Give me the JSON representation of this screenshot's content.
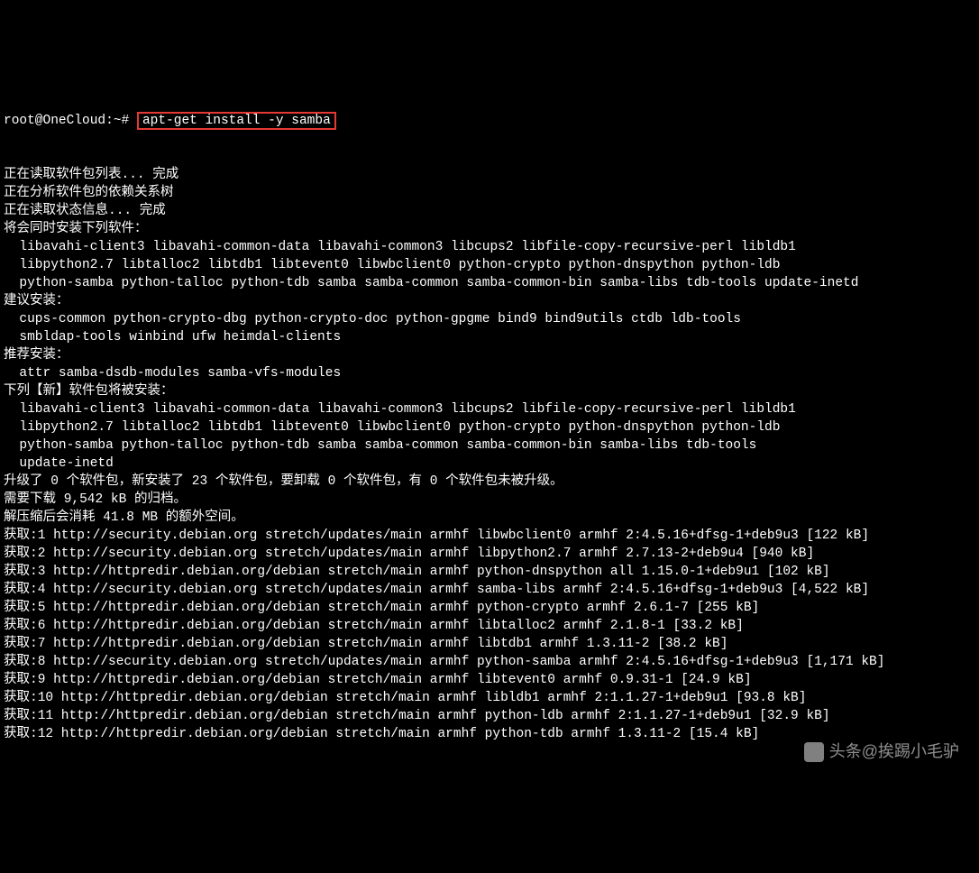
{
  "prompt": "root@OneCloud:~# ",
  "command": "apt-get install -y samba",
  "lines": [
    {
      "t": "正在读取软件包列表... 完成",
      "i": 0
    },
    {
      "t": "正在分析软件包的依赖关系树",
      "i": 0
    },
    {
      "t": "正在读取状态信息... 完成",
      "i": 0
    },
    {
      "t": "将会同时安装下列软件：",
      "i": 0
    },
    {
      "t": "libavahi-client3 libavahi-common-data libavahi-common3 libcups2 libfile-copy-recursive-perl libldb1",
      "i": 1
    },
    {
      "t": "libpython2.7 libtalloc2 libtdb1 libtevent0 libwbclient0 python-crypto python-dnspython python-ldb",
      "i": 1
    },
    {
      "t": "python-samba python-talloc python-tdb samba samba-common samba-common-bin samba-libs tdb-tools update-inetd",
      "i": 1
    },
    {
      "t": "建议安装：",
      "i": 0
    },
    {
      "t": "cups-common python-crypto-dbg python-crypto-doc python-gpgme bind9 bind9utils ctdb ldb-tools",
      "i": 1
    },
    {
      "t": "smbldap-tools winbind ufw heimdal-clients",
      "i": 1
    },
    {
      "t": "推荐安装：",
      "i": 0
    },
    {
      "t": "attr samba-dsdb-modules samba-vfs-modules",
      "i": 1
    },
    {
      "t": "下列【新】软件包将被安装：",
      "i": 0
    },
    {
      "t": "libavahi-client3 libavahi-common-data libavahi-common3 libcups2 libfile-copy-recursive-perl libldb1",
      "i": 1
    },
    {
      "t": "libpython2.7 libtalloc2 libtdb1 libtevent0 libwbclient0 python-crypto python-dnspython python-ldb",
      "i": 1
    },
    {
      "t": "python-samba python-talloc python-tdb samba samba-common samba-common-bin samba-libs tdb-tools",
      "i": 1
    },
    {
      "t": "update-inetd",
      "i": 1
    },
    {
      "t": "升级了 0 个软件包，新安装了 23 个软件包，要卸载 0 个软件包，有 0 个软件包未被升级。",
      "i": 0
    },
    {
      "t": "需要下载 9,542 kB 的归档。",
      "i": 0
    },
    {
      "t": "解压缩后会消耗 41.8 MB 的额外空间。",
      "i": 0
    },
    {
      "t": "获取:1 http://security.debian.org stretch/updates/main armhf libwbclient0 armhf 2:4.5.16+dfsg-1+deb9u3 [122 kB]",
      "i": 0
    },
    {
      "t": "获取:2 http://security.debian.org stretch/updates/main armhf libpython2.7 armhf 2.7.13-2+deb9u4 [940 kB]",
      "i": 0
    },
    {
      "t": "获取:3 http://httpredir.debian.org/debian stretch/main armhf python-dnspython all 1.15.0-1+deb9u1 [102 kB]",
      "i": 0
    },
    {
      "t": "获取:4 http://security.debian.org stretch/updates/main armhf samba-libs armhf 2:4.5.16+dfsg-1+deb9u3 [4,522 kB]",
      "i": 0
    },
    {
      "t": "获取:5 http://httpredir.debian.org/debian stretch/main armhf python-crypto armhf 2.6.1-7 [255 kB]",
      "i": 0
    },
    {
      "t": "获取:6 http://httpredir.debian.org/debian stretch/main armhf libtalloc2 armhf 2.1.8-1 [33.2 kB]",
      "i": 0
    },
    {
      "t": "获取:7 http://httpredir.debian.org/debian stretch/main armhf libtdb1 armhf 1.3.11-2 [38.2 kB]",
      "i": 0
    },
    {
      "t": "获取:8 http://security.debian.org stretch/updates/main armhf python-samba armhf 2:4.5.16+dfsg-1+deb9u3 [1,171 kB]",
      "i": 0
    },
    {
      "t": "获取:9 http://httpredir.debian.org/debian stretch/main armhf libtevent0 armhf 0.9.31-1 [24.9 kB]",
      "i": 0
    },
    {
      "t": "获取:10 http://httpredir.debian.org/debian stretch/main armhf libldb1 armhf 2:1.1.27-1+deb9u1 [93.8 kB]",
      "i": 0
    },
    {
      "t": "获取:11 http://httpredir.debian.org/debian stretch/main armhf python-ldb armhf 2:1.1.27-1+deb9u1 [32.9 kB]",
      "i": 0
    },
    {
      "t": "获取:12 http://httpredir.debian.org/debian stretch/main armhf python-tdb armhf 1.3.11-2 [15.4 kB]",
      "i": 0
    }
  ],
  "watermark": "头条@挨踢小毛驴"
}
